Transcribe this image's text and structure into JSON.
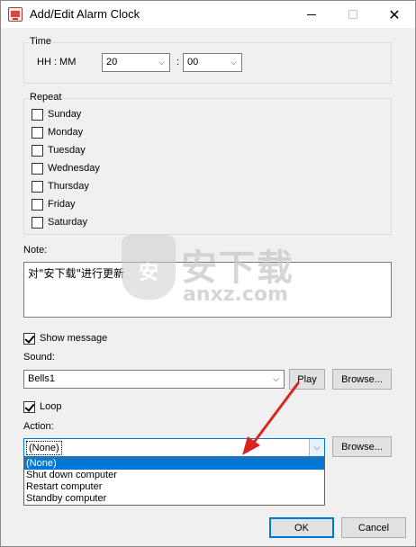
{
  "window": {
    "title": "Add/Edit Alarm Clock",
    "close_glyph": "✕"
  },
  "time": {
    "group_label": "Time",
    "hhmm_label": "HH : MM",
    "hour_value": "20",
    "separator": ":",
    "minute_value": "00"
  },
  "repeat": {
    "group_label": "Repeat",
    "days": [
      {
        "label": "Sunday",
        "checked": false
      },
      {
        "label": "Monday",
        "checked": false
      },
      {
        "label": "Tuesday",
        "checked": false
      },
      {
        "label": "Wednesday",
        "checked": false
      },
      {
        "label": "Thursday",
        "checked": false
      },
      {
        "label": "Friday",
        "checked": false
      },
      {
        "label": "Saturday",
        "checked": false
      }
    ]
  },
  "note": {
    "label": "Note:",
    "value": "对\"安下载\"进行更新"
  },
  "show_message": {
    "label": "Show message",
    "checked": true
  },
  "sound": {
    "label": "Sound:",
    "value": "Bells1",
    "play_label": "Play",
    "browse_label": "Browse..."
  },
  "loop": {
    "label": "Loop",
    "checked": true
  },
  "action": {
    "label": "Action:",
    "value": "(None)",
    "browse_label": "Browse...",
    "options": [
      "(None)",
      "Shut down computer",
      "Restart computer",
      "Standby computer"
    ],
    "selected_index": 0
  },
  "footer": {
    "ok_label": "OK",
    "cancel_label": "Cancel"
  },
  "watermark": {
    "shield_text": "安",
    "big_text": "安下载",
    "small_text": "anxz.com"
  },
  "colors": {
    "selection": "#0078d7",
    "annotation_arrow": "#d9261c"
  },
  "icons": {
    "app": "alarm-clock-app-icon",
    "minimize": "minimize-icon",
    "maximize": "maximize-icon",
    "close": "close-icon",
    "dropdown": "chevron-down-icon",
    "checkbox": "checkmark-icon",
    "arrow": "annotation-arrow-icon"
  }
}
